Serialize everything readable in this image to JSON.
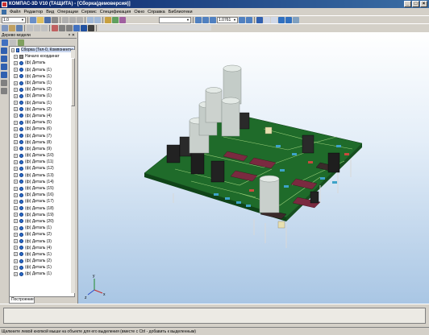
{
  "window": {
    "title": "КОМПАС-3D V10 (ТАЩИТА) - [Сборка(демоверсия)]"
  },
  "menu": [
    "Файл",
    "Редактор",
    "Вид",
    "Операции",
    "Сервис",
    "Спецификация",
    "Окно",
    "Справка",
    "Библиотеки"
  ],
  "toolbar": {
    "scale": "1.0",
    "zoom": "1.0761"
  },
  "panel": {
    "title": "Дерево модели",
    "tab": "Построение"
  },
  "tree": {
    "root": "Сборка (Тел-0, Компоненты-",
    "coord": "Начало координат",
    "items": [
      "(ф) Деталь",
      "(ф) Деталь (1)",
      "(ф) Деталь (1)",
      "(ф) Деталь (1)",
      "(ф) Деталь (2)",
      "(ф) Деталь (1)",
      "(ф) Деталь (1)",
      "(ф) Деталь (2)",
      "(ф) Деталь (4)",
      "(ф) Деталь (5)",
      "(ф) Деталь (6)",
      "(ф) Деталь (7)",
      "(ф) Деталь (8)",
      "(ф) Деталь (9)",
      "(ф) Деталь (10)",
      "(ф) Деталь (11)",
      "(ф) Деталь (12)",
      "(ф) Деталь (13)",
      "(ф) Деталь (14)",
      "(ф) Деталь (15)",
      "(ф) Деталь (16)",
      "(ф) Деталь (17)",
      "(ф) Деталь (18)",
      "(ф) Деталь (19)",
      "(ф) Деталь (20)",
      "(ф) Деталь (1)",
      "(ф) Деталь (2)",
      "(ф) Деталь (3)",
      "(ф) Деталь (4)",
      "(ф) Деталь (1)",
      "(ф) Деталь (2)",
      "(ф) Деталь (1)",
      "(ф) Деталь (1)"
    ]
  },
  "axes": {
    "x": "x",
    "y": "y",
    "z": "z"
  },
  "status": "Щелкните левой кнопкой мыши на объекте для его выделения (вместе с Ctrl - добавить к выделенным)",
  "colors": {
    "pcb": "#1f6b2a",
    "titlebar": "#0a246a",
    "chip": "#6b2036",
    "cap": "#c0c8c4"
  }
}
